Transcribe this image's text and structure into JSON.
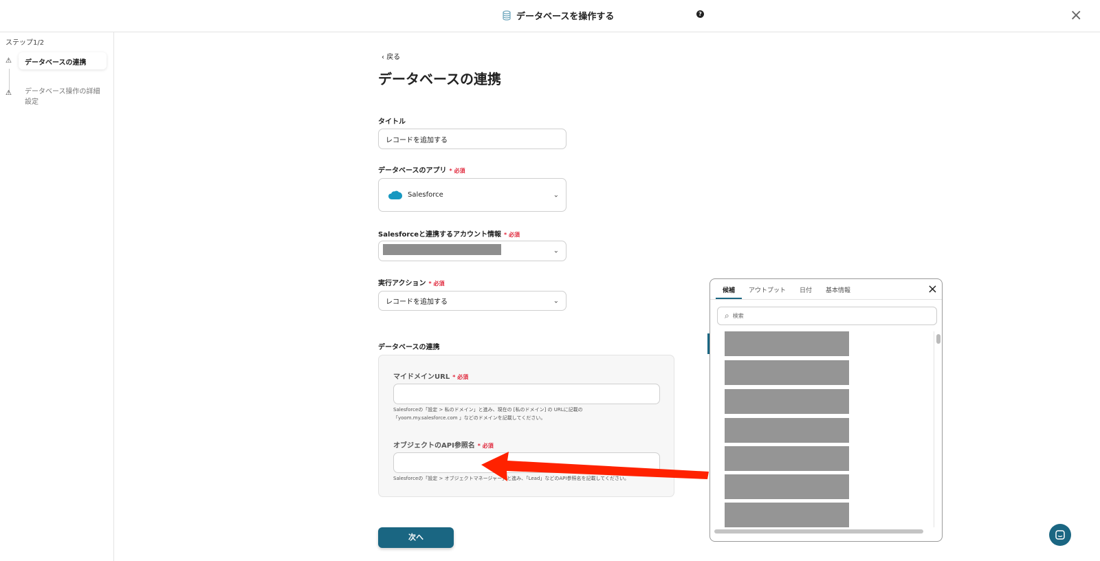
{
  "header": {
    "title": "データベースを操作する",
    "help": "?",
    "close": "×"
  },
  "sidebar": {
    "step": "ステップ1/2",
    "items": [
      {
        "label": "データベースの連携",
        "state": "active"
      },
      {
        "label": "データベース操作の詳細設定",
        "state": "inactive"
      }
    ]
  },
  "main": {
    "back": "戻る",
    "title": "データベースの連携",
    "title_field": {
      "label": "タイトル",
      "value": "レコードを追加する"
    },
    "app_field": {
      "label": "データベースのアプリ",
      "required": "必須",
      "value": "Salesforce"
    },
    "account_field": {
      "label": "Salesforceと連携するアカウント情報",
      "required": "必須"
    },
    "action_field": {
      "label": "実行アクション",
      "required": "必須",
      "value": "レコードを追加する"
    },
    "section_label": "データベースの連携",
    "domain_field": {
      "label": "マイドメインURL",
      "required": "必須",
      "value": "",
      "hint1": "Salesforceの「設定 > 私のドメイン」と進み、現在の [私のドメイン] の URLに記載の",
      "hint2": "「yoom.my.salesforce.com 」などのドメインを記載してください。"
    },
    "api_field": {
      "label": "オブジェクトのAPI参照名",
      "required": "必須",
      "value": "",
      "hint": "Salesforceの「設定 > オブジェクトマネージャー」と進み、「Lead」などのAPI参照名を記載してください。"
    },
    "next": "次へ"
  },
  "panel": {
    "tabs": [
      "候補",
      "アウトプット",
      "日付",
      "基本情報"
    ],
    "active_tab": "候補",
    "search_placeholder": "検索",
    "close": "×"
  },
  "colors": {
    "primary": "#1a6682",
    "required": "#e0263a",
    "arrow": "#ff2200"
  }
}
